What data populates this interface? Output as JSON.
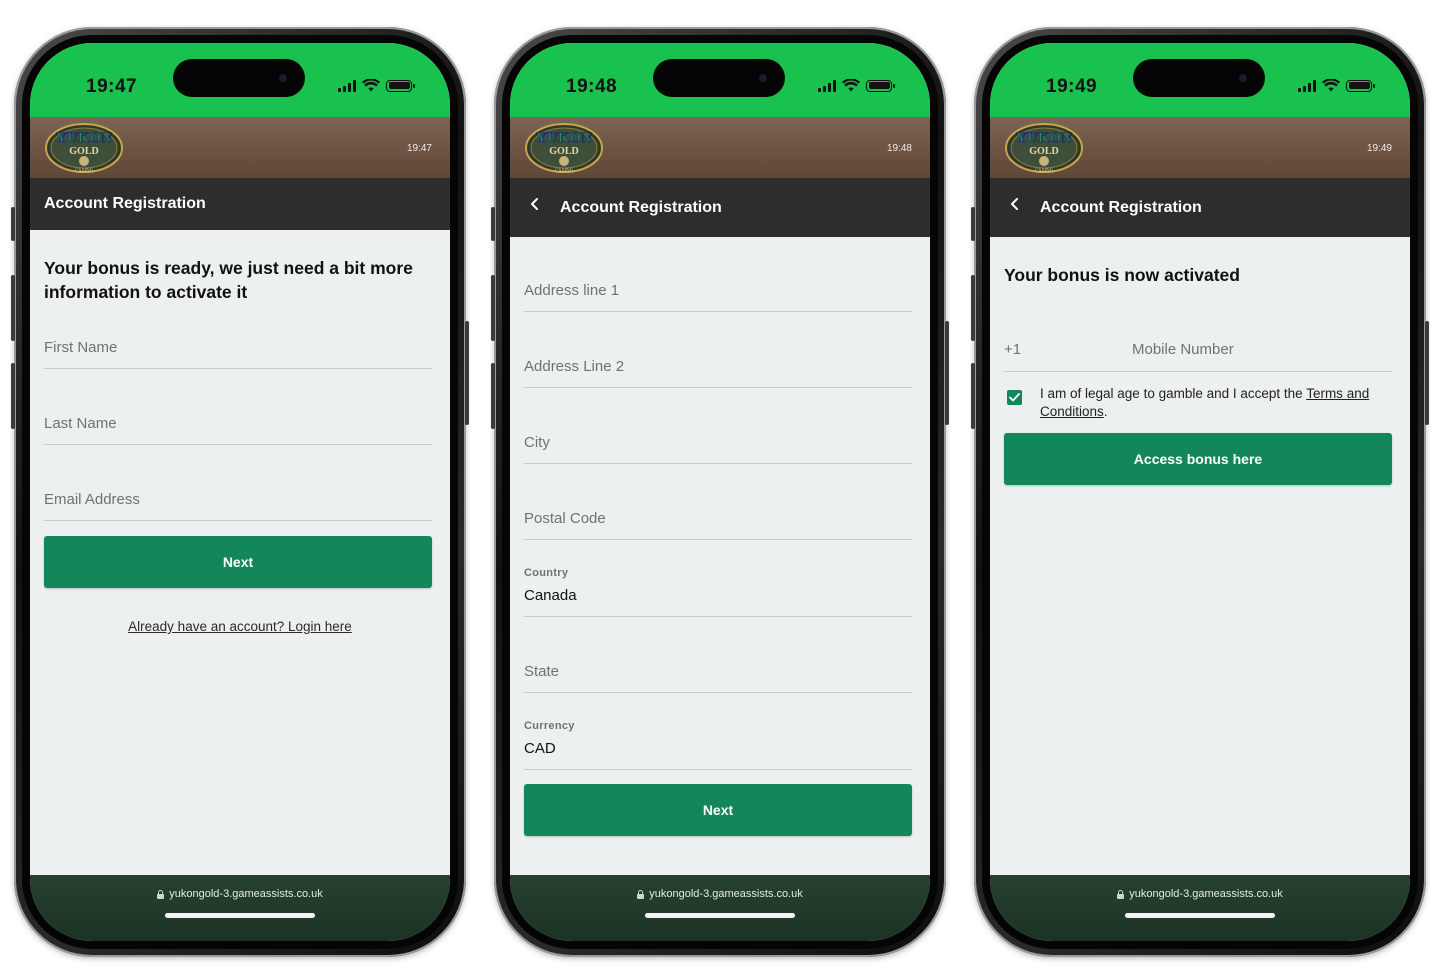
{
  "colors": {
    "status_green": "#19c24e",
    "banner_brown": "#6b5241",
    "appbar_dark": "#2e2c2c",
    "button_green": "#14875a",
    "bottom_bar": "#1c3324",
    "background": "#ecf0f0"
  },
  "brand": {
    "logo_top": "YUKON",
    "logo_mid": "GOLD",
    "logo_bottom": "CASINO"
  },
  "url": "yukongold-3.gameassists.co.uk",
  "screens": [
    {
      "status_time": "19:47",
      "banner_time": "19:47",
      "appbar_title": "Account Registration",
      "heading": "Your bonus is ready, we just need a bit more information to activate it",
      "fields": [
        {
          "placeholder": "First Name"
        },
        {
          "placeholder": "Last Name"
        },
        {
          "placeholder": "Email Address"
        }
      ],
      "button": "Next",
      "login_link": "Already have an account? Login here"
    },
    {
      "status_time": "19:48",
      "banner_time": "19:48",
      "appbar_title": "Account Registration",
      "fields": [
        {
          "placeholder": "Address line 1"
        },
        {
          "placeholder": "Address Line 2"
        },
        {
          "placeholder": "City"
        },
        {
          "placeholder": "Postal Code"
        },
        {
          "label": "Country",
          "value": "Canada"
        },
        {
          "placeholder": "State"
        },
        {
          "label": "Currency",
          "value": "CAD"
        }
      ],
      "button": "Next"
    },
    {
      "status_time": "19:49",
      "banner_time": "19:49",
      "appbar_title": "Account Registration",
      "heading": "Your bonus is now activated",
      "phone_code": "+1",
      "phone_placeholder": "Mobile Number",
      "consent_checked": true,
      "consent_text": "I am of legal age to gamble and I accept the ",
      "consent_link": "Terms and Conditions",
      "consent_end": ".",
      "button": "Access bonus here"
    }
  ]
}
